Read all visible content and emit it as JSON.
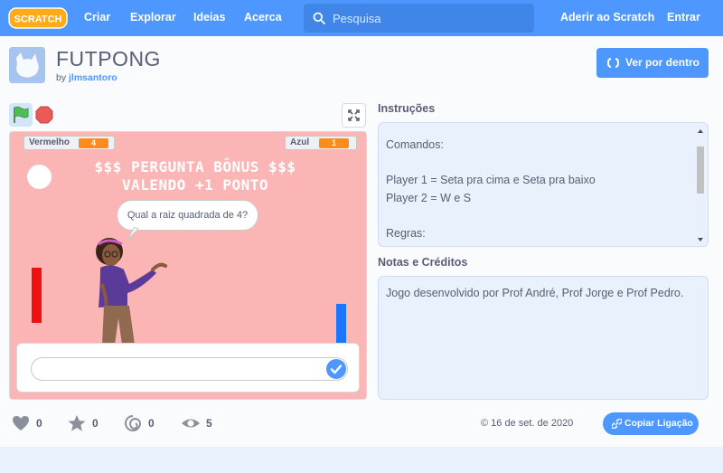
{
  "nav": {
    "logo_text": "SCRATCH",
    "links": [
      "Criar",
      "Explorar",
      "Ideias",
      "Acerca"
    ],
    "search_placeholder": "Pesquisa",
    "join": "Aderir ao Scratch",
    "signin": "Entrar"
  },
  "project": {
    "title": "FUTPONG",
    "by": "by",
    "author": "jlmsantoro",
    "see_inside": "Ver por dentro"
  },
  "stage": {
    "monitors": [
      {
        "label": "Vermelho",
        "value": "4"
      },
      {
        "label": "Azul",
        "value": "1"
      }
    ],
    "banner_line1": "$$$ PERGUNTA BÔNUS $$$",
    "banner_line2": "VALENDO +1 PONTO",
    "speech": "Qual a raiz quadrada de 4?"
  },
  "instructions": {
    "label": "Instruções",
    "lines": [
      "Comandos:",
      "",
      "Player 1 = Seta pra cima e Seta pra baixo",
      "Player 2 = W e S",
      "",
      "Regras:"
    ]
  },
  "notes": {
    "label": "Notas e Créditos",
    "text": "Jogo desenvolvido por Prof André, Prof Jorge e Prof Pedro."
  },
  "stats": {
    "loves": "0",
    "favorites": "0",
    "remixes": "0",
    "views": "5"
  },
  "footer": {
    "date": "16 de set. de 2020",
    "copy_link": "Copiar Ligação"
  },
  "colors": {
    "brand_blue": "#4d97ff",
    "stage_bg": "#fbb5b5",
    "monitor_orange": "#ff8c1a",
    "paddle_red": "#ee1111",
    "paddle_blue": "#1a75ff"
  },
  "icons": [
    "scratch-logo",
    "search-icon",
    "see-inside-icon",
    "green-flag-icon",
    "stop-icon",
    "fullscreen-icon",
    "check-icon",
    "heart-icon",
    "star-icon",
    "remix-icon",
    "eye-icon",
    "copyright-icon",
    "link-icon"
  ]
}
